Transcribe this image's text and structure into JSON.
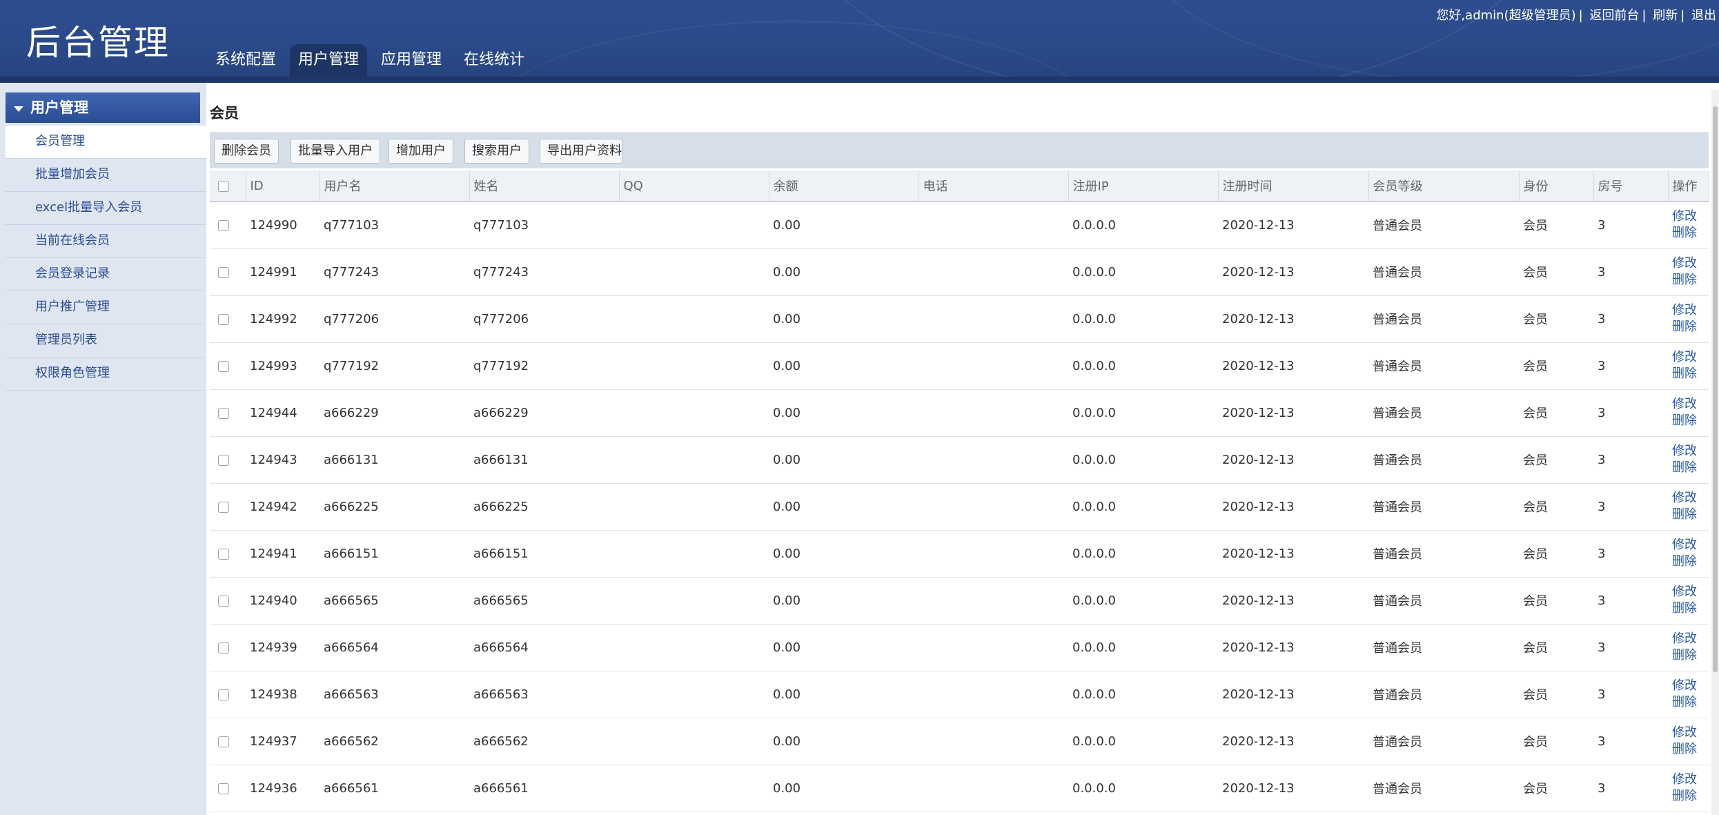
{
  "header": {
    "logo": "后台管理",
    "nav": [
      "系统配置",
      "用户管理",
      "应用管理",
      "在线统计"
    ],
    "active_tab": 1,
    "greeting": "您好,admin(超级管理员)",
    "links": [
      "返回前台",
      "刷新",
      "退出"
    ]
  },
  "sidebar": {
    "section": "用户管理",
    "items": [
      {
        "label": "会员管理"
      },
      {
        "label": "批量增加会员"
      },
      {
        "label": "excel批量导入会员"
      },
      {
        "label": "当前在线会员"
      },
      {
        "label": "会员登录记录"
      },
      {
        "label": "用户推广管理"
      },
      {
        "label": "管理员列表"
      },
      {
        "label": "权限角色管理"
      }
    ]
  },
  "main": {
    "title": "会员",
    "toolbar": [
      "删除会员",
      "批量导入用户",
      "增加用户",
      "搜索用户",
      "导出用户资料"
    ],
    "columns": [
      "ID",
      "用户名",
      "姓名",
      "QQ",
      "余额",
      "电话",
      "注册IP",
      "注册时间",
      "会员等级",
      "身份",
      "房号",
      "操作"
    ],
    "op_edit": "修改",
    "op_delete": "删除",
    "rows": [
      {
        "id": "124990",
        "username": "q777103",
        "name": "q777103",
        "qq": "",
        "balance": "0.00",
        "phone": "",
        "ip": "0.0.0.0",
        "date": "2020-12-13",
        "level": "普通会员",
        "role": "会员",
        "room": "3"
      },
      {
        "id": "124991",
        "username": "q777243",
        "name": "q777243",
        "qq": "",
        "balance": "0.00",
        "phone": "",
        "ip": "0.0.0.0",
        "date": "2020-12-13",
        "level": "普通会员",
        "role": "会员",
        "room": "3"
      },
      {
        "id": "124992",
        "username": "q777206",
        "name": "q777206",
        "qq": "",
        "balance": "0.00",
        "phone": "",
        "ip": "0.0.0.0",
        "date": "2020-12-13",
        "level": "普通会员",
        "role": "会员",
        "room": "3"
      },
      {
        "id": "124993",
        "username": "q777192",
        "name": "q777192",
        "qq": "",
        "balance": "0.00",
        "phone": "",
        "ip": "0.0.0.0",
        "date": "2020-12-13",
        "level": "普通会员",
        "role": "会员",
        "room": "3"
      },
      {
        "id": "124944",
        "username": "a666229",
        "name": "a666229",
        "qq": "",
        "balance": "0.00",
        "phone": "",
        "ip": "0.0.0.0",
        "date": "2020-12-13",
        "level": "普通会员",
        "role": "会员",
        "room": "3"
      },
      {
        "id": "124943",
        "username": "a666131",
        "name": "a666131",
        "qq": "",
        "balance": "0.00",
        "phone": "",
        "ip": "0.0.0.0",
        "date": "2020-12-13",
        "level": "普通会员",
        "role": "会员",
        "room": "3"
      },
      {
        "id": "124942",
        "username": "a666225",
        "name": "a666225",
        "qq": "",
        "balance": "0.00",
        "phone": "",
        "ip": "0.0.0.0",
        "date": "2020-12-13",
        "level": "普通会员",
        "role": "会员",
        "room": "3"
      },
      {
        "id": "124941",
        "username": "a666151",
        "name": "a666151",
        "qq": "",
        "balance": "0.00",
        "phone": "",
        "ip": "0.0.0.0",
        "date": "2020-12-13",
        "level": "普通会员",
        "role": "会员",
        "room": "3"
      },
      {
        "id": "124940",
        "username": "a666565",
        "name": "a666565",
        "qq": "",
        "balance": "0.00",
        "phone": "",
        "ip": "0.0.0.0",
        "date": "2020-12-13",
        "level": "普通会员",
        "role": "会员",
        "room": "3"
      },
      {
        "id": "124939",
        "username": "a666564",
        "name": "a666564",
        "qq": "",
        "balance": "0.00",
        "phone": "",
        "ip": "0.0.0.0",
        "date": "2020-12-13",
        "level": "普通会员",
        "role": "会员",
        "room": "3"
      },
      {
        "id": "124938",
        "username": "a666563",
        "name": "a666563",
        "qq": "",
        "balance": "0.00",
        "phone": "",
        "ip": "0.0.0.0",
        "date": "2020-12-13",
        "level": "普通会员",
        "role": "会员",
        "room": "3"
      },
      {
        "id": "124937",
        "username": "a666562",
        "name": "a666562",
        "qq": "",
        "balance": "0.00",
        "phone": "",
        "ip": "0.0.0.0",
        "date": "2020-12-13",
        "level": "普通会员",
        "role": "会员",
        "room": "3"
      },
      {
        "id": "124936",
        "username": "a666561",
        "name": "a666561",
        "qq": "",
        "balance": "0.00",
        "phone": "",
        "ip": "0.0.0.0",
        "date": "2020-12-13",
        "level": "普通会员",
        "role": "会员",
        "room": "3"
      }
    ]
  },
  "colors": {
    "header": "#2b4a8a",
    "sidebar": "#dfe6f2",
    "link": "#2b5aa8",
    "toolbar": "#d6deea"
  }
}
